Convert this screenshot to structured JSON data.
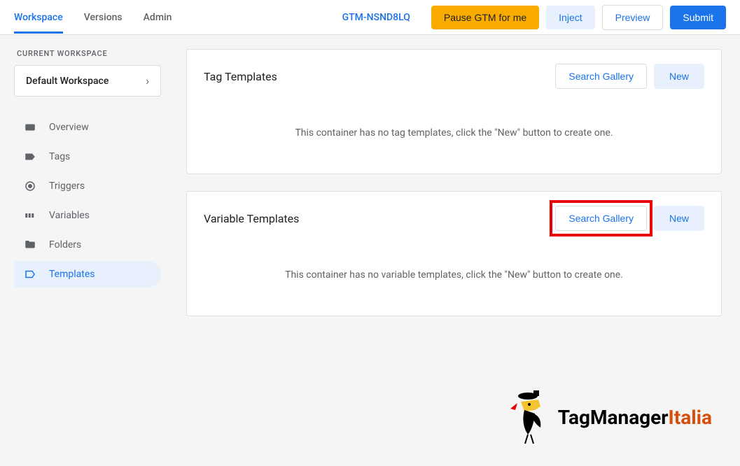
{
  "tabs": {
    "workspace": "Workspace",
    "versions": "Versions",
    "admin": "Admin"
  },
  "topBar": {
    "containerId": "GTM-NSND8LQ",
    "pauseLabel": "Pause GTM for me",
    "injectLabel": "Inject",
    "previewLabel": "Preview",
    "submitLabel": "Submit"
  },
  "sidebar": {
    "title": "CURRENT WORKSPACE",
    "workspaceName": "Default Workspace",
    "items": {
      "overview": "Overview",
      "tags": "Tags",
      "triggers": "Triggers",
      "variables": "Variables",
      "folders": "Folders",
      "templates": "Templates"
    }
  },
  "cards": {
    "tagTemplates": {
      "title": "Tag Templates",
      "searchLabel": "Search Gallery",
      "newLabel": "New",
      "emptyText": "This container has no tag templates, click the \"New\" button to create one."
    },
    "variableTemplates": {
      "title": "Variable Templates",
      "searchLabel": "Search Gallery",
      "newLabel": "New",
      "emptyText": "This container has no variable templates, click the \"New\" button to create one."
    }
  },
  "footer": {
    "logoText1": "TagManager",
    "logoText2": "Italia"
  }
}
